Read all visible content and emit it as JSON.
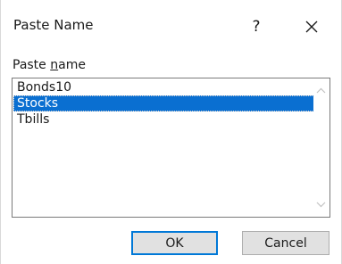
{
  "dialog": {
    "title": "Paste Name",
    "help_label": "?",
    "close_icon": "close-icon"
  },
  "paste_name": {
    "label_prefix": "Paste ",
    "label_accel": "n",
    "label_suffix": "ame",
    "items": [
      {
        "label": "Bonds10",
        "selected": false
      },
      {
        "label": "Stocks",
        "selected": true
      },
      {
        "label": "Tbills",
        "selected": false
      }
    ],
    "scroll_up_icon": "chevron-up-icon",
    "scroll_down_icon": "chevron-down-icon"
  },
  "buttons": {
    "ok_label": "OK",
    "cancel_label": "Cancel"
  },
  "colors": {
    "selection": "#0a6fd1",
    "default_button_border": "#0078d7"
  }
}
